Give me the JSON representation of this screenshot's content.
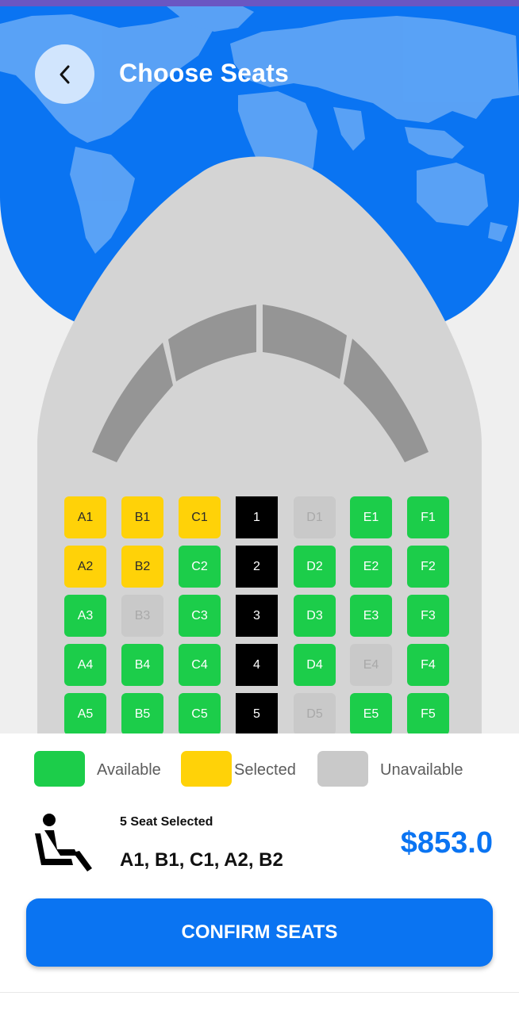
{
  "header": {
    "title": "Choose Seats",
    "back_icon": "chevron-left-icon"
  },
  "colors": {
    "primary": "#0a74f2",
    "available": "#1ccd4a",
    "selected": "#ffd208",
    "unavailable": "#c9c9c9",
    "row_number": "#000000"
  },
  "seat_map": {
    "rows": [
      {
        "number": "1",
        "seats": [
          {
            "id": "A1",
            "status": "selected"
          },
          {
            "id": "B1",
            "status": "selected"
          },
          {
            "id": "C1",
            "status": "selected"
          },
          {
            "id": "D1",
            "status": "unavailable"
          },
          {
            "id": "E1",
            "status": "available"
          },
          {
            "id": "F1",
            "status": "available"
          }
        ]
      },
      {
        "number": "2",
        "seats": [
          {
            "id": "A2",
            "status": "selected"
          },
          {
            "id": "B2",
            "status": "selected"
          },
          {
            "id": "C2",
            "status": "available"
          },
          {
            "id": "D2",
            "status": "available"
          },
          {
            "id": "E2",
            "status": "available"
          },
          {
            "id": "F2",
            "status": "available"
          }
        ]
      },
      {
        "number": "3",
        "seats": [
          {
            "id": "A3",
            "status": "available"
          },
          {
            "id": "B3",
            "status": "unavailable"
          },
          {
            "id": "C3",
            "status": "available"
          },
          {
            "id": "D3",
            "status": "available"
          },
          {
            "id": "E3",
            "status": "available"
          },
          {
            "id": "F3",
            "status": "available"
          }
        ]
      },
      {
        "number": "4",
        "seats": [
          {
            "id": "A4",
            "status": "available"
          },
          {
            "id": "B4",
            "status": "available"
          },
          {
            "id": "C4",
            "status": "available"
          },
          {
            "id": "D4",
            "status": "available"
          },
          {
            "id": "E4",
            "status": "unavailable"
          },
          {
            "id": "F4",
            "status": "available"
          }
        ]
      },
      {
        "number": "5",
        "seats": [
          {
            "id": "A5",
            "status": "available"
          },
          {
            "id": "B5",
            "status": "available"
          },
          {
            "id": "C5",
            "status": "available"
          },
          {
            "id": "D5",
            "status": "unavailable"
          },
          {
            "id": "E5",
            "status": "available"
          },
          {
            "id": "F5",
            "status": "available"
          }
        ]
      }
    ]
  },
  "legend": {
    "available": "Available",
    "selected": "Selected",
    "unavailable": "Unavailable"
  },
  "summary": {
    "icon": "seated-passenger-icon",
    "count_text": "5 Seat Selected",
    "seats_text": "A1, B1, C1, A2, B2",
    "price": "$853.0"
  },
  "confirm_button": {
    "label": "CONFIRM SEATS"
  }
}
